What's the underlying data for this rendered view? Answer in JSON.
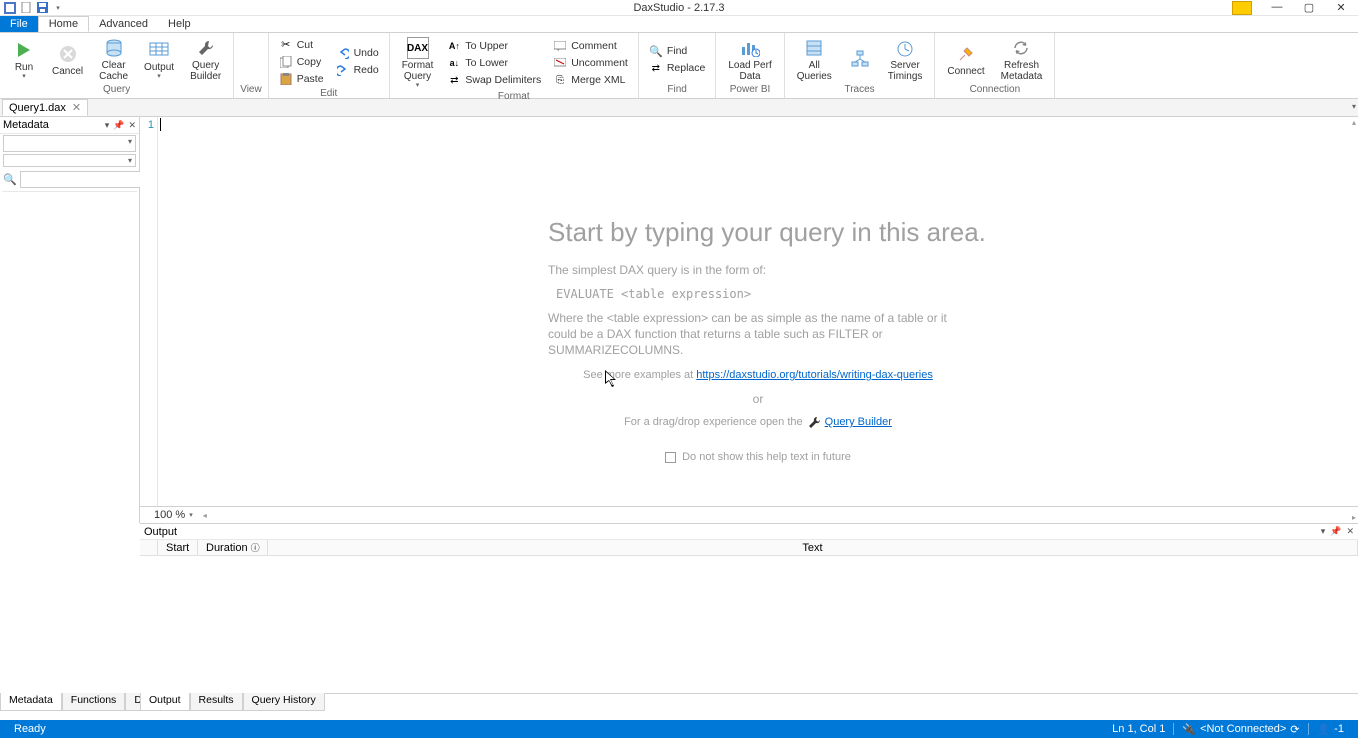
{
  "titlebar": {
    "title": "DaxStudio - 2.17.3"
  },
  "menu": {
    "file": "File",
    "home": "Home",
    "advanced": "Advanced",
    "help": "Help"
  },
  "ribbon": {
    "query": {
      "label": "Query",
      "run": "Run",
      "cancel": "Cancel",
      "clear": "Clear\nCache",
      "output": "Output",
      "builder": "Query\nBuilder"
    },
    "view": {
      "label": "View"
    },
    "edit": {
      "label": "Edit",
      "cut": "Cut",
      "copy": "Copy",
      "paste": "Paste",
      "undo": "Undo",
      "redo": "Redo"
    },
    "format": {
      "label": "Format",
      "formatq": "Format\nQuery",
      "upper": "To Upper",
      "lower": "To Lower",
      "swap": "Swap Delimiters",
      "comment": "Comment",
      "uncomment": "Uncomment",
      "merge": "Merge XML"
    },
    "find": {
      "label": "Find",
      "find": "Find",
      "replace": "Replace"
    },
    "powerbi": {
      "label": "Power BI",
      "load": "Load Perf\nData"
    },
    "traces": {
      "label": "Traces",
      "all": "All\nQueries",
      "plan": "Query\nPlan",
      "timings": "Server\nTimings"
    },
    "connection": {
      "label": "Connection",
      "connect": "Connect",
      "refresh": "Refresh\nMetadata"
    }
  },
  "docTab": {
    "name": "Query1.dax"
  },
  "sidebar": {
    "title": "Metadata",
    "tabs": {
      "metadata": "Metadata",
      "functions": "Functions",
      "dmv": "DMV"
    }
  },
  "editor": {
    "line": "1",
    "zoom": "100 %",
    "wm_title": "Start by typing your query in this area.",
    "wm_p1": "The simplest DAX query is in the form of:",
    "wm_code": "EVALUATE <table expression>",
    "wm_p2": "Where the <table expression> can be as simple as the name of a table or it could be a DAX function that returns a table such as FILTER or SUMMARIZECOLUMNS.",
    "wm_see": "See more examples at ",
    "wm_link": "https://daxstudio.org/tutorials/writing-dax-queries",
    "wm_or": "or",
    "wm_drag": "For a drag/drop experience open the",
    "wm_qb": "Query Builder",
    "wm_chk": "Do not show this help text in future"
  },
  "output": {
    "title": "Output",
    "col_empty": "",
    "col_start": "Start",
    "col_dur": "Duration",
    "col_text": "Text",
    "tabs": {
      "output": "Output",
      "results": "Results",
      "history": "Query History"
    }
  },
  "status": {
    "ready": "Ready",
    "pos": "Ln 1, Col 1",
    "conn": "<Not Connected>",
    "user": "-1"
  }
}
